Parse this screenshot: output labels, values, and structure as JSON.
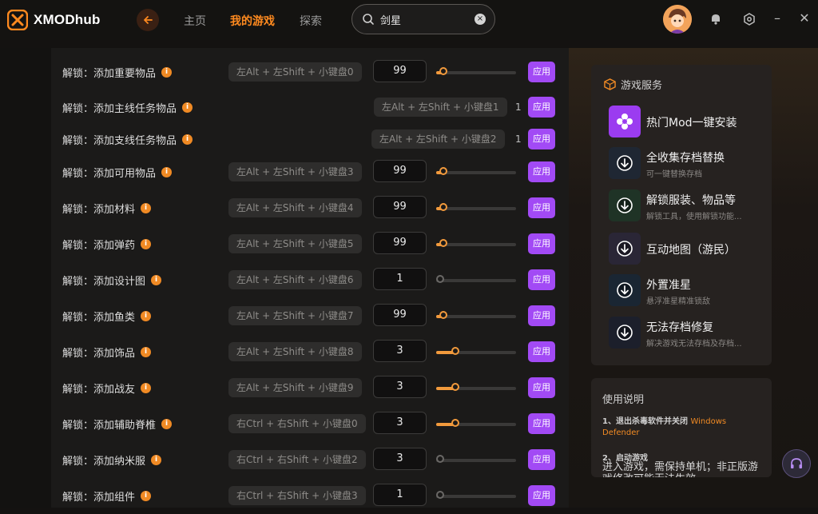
{
  "app": {
    "name": "XMODhub"
  },
  "nav": [
    {
      "label": "主页",
      "active": false
    },
    {
      "label": "我的游戏",
      "active": true
    },
    {
      "label": "探索",
      "active": false
    }
  ],
  "search": {
    "value": "剑星",
    "clear_symbol": "×"
  },
  "window_controls": {
    "minimize": "–",
    "close": "✕"
  },
  "colors": {
    "accent": "#ff8a1f",
    "apply": "#a24af5",
    "slider": "#f29a3c"
  },
  "apply_label": "应用",
  "rows": [
    {
      "label": "解锁：添加重要物品",
      "hotkey": "左Alt + 左Shift + 小键盘0",
      "value": "99",
      "level": 0.07,
      "control": "input"
    },
    {
      "label": "解锁：添加主线任务物品",
      "hotkey": "左Alt + 左Shift + 小键盘1",
      "value": "1",
      "control": "plain"
    },
    {
      "label": "解锁：添加支线任务物品",
      "hotkey": "左Alt + 左Shift + 小键盘2",
      "value": "1",
      "control": "plain"
    },
    {
      "label": "解锁：添加可用物品",
      "hotkey": "左Alt + 左Shift + 小键盘3",
      "value": "99",
      "level": 0.07,
      "control": "input"
    },
    {
      "label": "解锁：添加材料",
      "hotkey": "左Alt + 左Shift + 小键盘4",
      "value": "99",
      "level": 0.07,
      "control": "input"
    },
    {
      "label": "解锁：添加弹药",
      "hotkey": "左Alt + 左Shift + 小键盘5",
      "value": "99",
      "level": 0.07,
      "control": "input"
    },
    {
      "label": "解锁：添加设计图",
      "hotkey": "左Alt + 左Shift + 小键盘6",
      "value": "1",
      "level": 0.0,
      "control": "input"
    },
    {
      "label": "解锁：添加鱼类",
      "hotkey": "左Alt + 左Shift + 小键盘7",
      "value": "99",
      "level": 0.07,
      "control": "input"
    },
    {
      "label": "解锁：添加饰品",
      "hotkey": "左Alt + 左Shift + 小键盘8",
      "value": "3",
      "level": 0.22,
      "control": "input"
    },
    {
      "label": "解锁：添加战友",
      "hotkey": "左Alt + 左Shift + 小键盘9",
      "value": "3",
      "level": 0.22,
      "control": "input"
    },
    {
      "label": "解锁：添加辅助脊椎",
      "hotkey": "右Ctrl + 右Shift + 小键盘0",
      "value": "3",
      "level": 0.22,
      "control": "input"
    },
    {
      "label": "解锁：添加纳米服",
      "hotkey": "右Ctrl + 右Shift + 小键盘2",
      "value": "3",
      "level": 0.0,
      "control": "input"
    },
    {
      "label": "解锁：添加组件",
      "hotkey": "右Ctrl + 右Shift + 小键盘3",
      "value": "1",
      "level": 0.0,
      "control": "input"
    }
  ],
  "services": {
    "title": "游戏服务",
    "items": [
      {
        "name": "热门Mod一键安装",
        "desc": "",
        "icon": "flower-icon",
        "bg": "#9b3cf0"
      },
      {
        "name": "全收集存档替换",
        "desc": "可一键替换存档",
        "icon": "download-icon",
        "bg": "#1f2733"
      },
      {
        "name": "解锁服装、物品等",
        "desc": "解锁工具，使用解锁功能...",
        "icon": "download-icon",
        "bg": "#1f3326"
      },
      {
        "name": "互动地图（游民）",
        "desc": "",
        "icon": "download-icon",
        "bg": "#2a2636"
      },
      {
        "name": "外置准星",
        "desc": "悬浮准星精准锁敌",
        "icon": "download-icon",
        "bg": "#1a2633"
      },
      {
        "name": "无法存档修复",
        "desc": "解决游戏无法存档及存档...",
        "icon": "download-icon",
        "bg": "#1c1f2b"
      }
    ]
  },
  "usage": {
    "title": "使用说明",
    "step1": "1、退出杀毒软件并关闭",
    "step1_highlight": "Windows Defender",
    "step2": "2、启动游戏",
    "step2_body": "进入游戏，需保持单机；非正版游戏修改可能无法生效"
  }
}
